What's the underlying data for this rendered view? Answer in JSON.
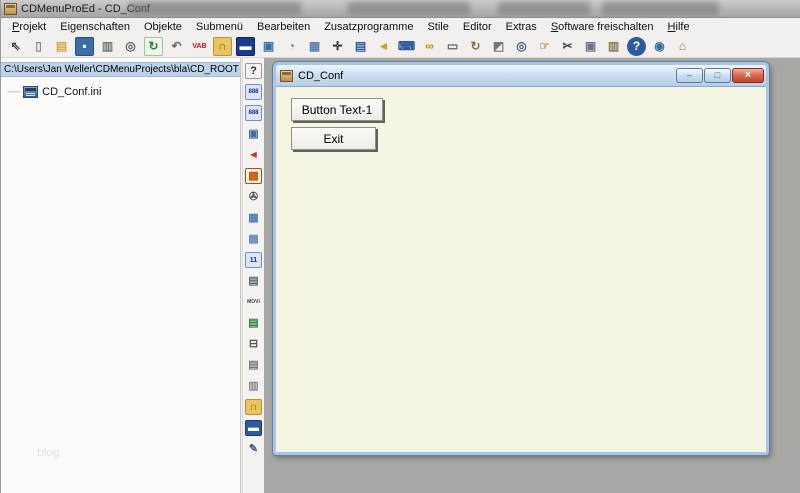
{
  "window": {
    "title": "CDMenuProEd - CD_Conf"
  },
  "menu": {
    "items": [
      {
        "name": "menu-projekt",
        "pre": "",
        "key": "P",
        "post": "rojekt"
      },
      {
        "name": "menu-eigenschaften",
        "pre": "Eigenschaften",
        "key": "",
        "post": ""
      },
      {
        "name": "menu-objekte",
        "pre": "Objekte",
        "key": "",
        "post": ""
      },
      {
        "name": "menu-submenu",
        "pre": "Submenü",
        "key": "",
        "post": ""
      },
      {
        "name": "menu-bearbeiten",
        "pre": "Bearbeiten",
        "key": "",
        "post": ""
      },
      {
        "name": "menu-zusatzprogramme",
        "pre": "Zusatzprogramme",
        "key": "",
        "post": ""
      },
      {
        "name": "menu-stile",
        "pre": "Stile",
        "key": "",
        "post": ""
      },
      {
        "name": "menu-editor",
        "pre": "Editor",
        "key": "",
        "post": ""
      },
      {
        "name": "menu-extras",
        "pre": "Extras",
        "key": "",
        "post": ""
      },
      {
        "name": "menu-software-freischalten",
        "pre": "",
        "key": "S",
        "post": "oftware freischalten"
      },
      {
        "name": "menu-hilfe",
        "pre": "",
        "key": "H",
        "post": "ilfe"
      }
    ]
  },
  "toolbar": {
    "icons": [
      {
        "name": "select-tool-icon",
        "glyph": "⇖",
        "fg": "#3a3a3a"
      },
      {
        "name": "new-file-icon",
        "glyph": "▯",
        "fg": "#8a8a8a"
      },
      {
        "name": "open-folder-icon",
        "glyph": "▤",
        "fg": "#d9a93f"
      },
      {
        "name": "save-icon",
        "glyph": "▪",
        "fg": "#ffffff",
        "bg": "#3a6ea5",
        "bd": "#28507a"
      },
      {
        "name": "print-icon",
        "glyph": "▥",
        "fg": "#6b7d6e"
      },
      {
        "name": "print-preview-icon",
        "glyph": "◎",
        "fg": "#55606e"
      },
      {
        "name": "refresh-icon",
        "glyph": "↻",
        "fg": "#2e7d32",
        "bg": "#eef6ee",
        "bd": "#9bc49d"
      },
      {
        "name": "undo-icon",
        "glyph": "↶",
        "fg": "#666666"
      },
      {
        "name": "vab-icon",
        "glyph": "VAB",
        "fg": "#cc1111",
        "fs": 7
      },
      {
        "name": "lock-icon",
        "glyph": "∩",
        "fg": "#7c5f12",
        "bg": "#eac45e",
        "bd": "#b8923a"
      },
      {
        "name": "cmd-window-icon",
        "glyph": "▬",
        "fg": "#ffffff",
        "bg": "#1b3c8c",
        "bd": "#0f2356"
      },
      {
        "name": "monitor-icon",
        "glyph": "▣",
        "fg": "#3a6ea5"
      },
      {
        "name": "screensaver-icon",
        "glyph": "◔",
        "fg": "#4a7ebb"
      },
      {
        "name": "image-icon",
        "glyph": "▦",
        "fg": "#5b7fb4"
      },
      {
        "name": "fullscreen-icon",
        "glyph": "✛",
        "fg": "#333333"
      },
      {
        "name": "window-style-icon",
        "glyph": "▤",
        "fg": "#2c5aa0"
      },
      {
        "name": "speaker-icon",
        "glyph": "◄",
        "fg": "#d4a017"
      },
      {
        "name": "keyboard-icon",
        "glyph": "⌨",
        "fg": "#2c5aa0"
      },
      {
        "name": "link-icon",
        "glyph": "∞",
        "fg": "#b8960c"
      },
      {
        "name": "selection-rect-icon",
        "glyph": "▭",
        "fg": "#666666"
      },
      {
        "name": "rotate-icon",
        "glyph": "↻",
        "fg": "#8a6b4f"
      },
      {
        "name": "resize-icon",
        "glyph": "◩",
        "fg": "#777777"
      },
      {
        "name": "find-image-icon",
        "glyph": "◎",
        "fg": "#3a5e8c"
      },
      {
        "name": "hand-icon",
        "glyph": "☞",
        "fg": "#c9a063"
      },
      {
        "name": "cut-icon",
        "glyph": "✂",
        "fg": "#444444"
      },
      {
        "name": "copy-icon",
        "glyph": "▣",
        "fg": "#6a7686"
      },
      {
        "name": "paste-icon",
        "glyph": "▥",
        "fg": "#8a7c5a"
      },
      {
        "name": "help-icon",
        "glyph": "?",
        "fg": "#ffffff",
        "bg": "#2c5aa0",
        "rd": 1
      },
      {
        "name": "web-icon",
        "glyph": "◉",
        "fg": "#3a6ea5"
      },
      {
        "name": "home-icon",
        "glyph": "⌂",
        "fg": "#a0722d"
      }
    ]
  },
  "tree_panel": {
    "path": "C:\\Users\\Jan Weller\\CDMenuProjects\\bla\\CD_ROOT",
    "items": [
      {
        "name": "tree-item-cd-conf-ini",
        "label": "CD_Conf.ini"
      }
    ],
    "watermark": "blog"
  },
  "side_toolbar": {
    "icons": [
      {
        "name": "context-help-icon",
        "glyph": "?",
        "fg": "#333333",
        "bd": "#999999"
      },
      {
        "name": "counter-display-icon",
        "glyph": "888",
        "fg": "#1a2e8c",
        "bg": "#dde6f5",
        "bd": "#7a8db8",
        "fs": 6
      },
      {
        "name": "counter-display2-icon",
        "glyph": "888",
        "fg": "#1a2e8c",
        "bg": "#dde6f5",
        "bd": "#7a8db8",
        "fs": 6
      },
      {
        "name": "windows-copy-icon",
        "glyph": "▣",
        "fg": "#3a6ea5"
      },
      {
        "name": "megaphone-icon",
        "glyph": "◄",
        "fg": "#c0392b"
      },
      {
        "name": "fire-icon",
        "glyph": "▩",
        "fg": "#d35400",
        "bd": "#b34a00"
      },
      {
        "name": "projector-icon",
        "glyph": "✇",
        "fg": "#555555"
      },
      {
        "name": "picture-icon",
        "glyph": "▦",
        "fg": "#4a7ebb"
      },
      {
        "name": "picture2-icon",
        "glyph": "▩",
        "fg": "#6c8cc0"
      },
      {
        "name": "counter11-icon",
        "glyph": "11",
        "fg": "#1a2e8c",
        "bg": "#dde6f5",
        "bd": "#7a8db8",
        "fs": 7
      },
      {
        "name": "calendar-icon",
        "glyph": "▤",
        "fg": "#556677"
      },
      {
        "name": "movie-icon",
        "glyph": "MOVI",
        "fg": "#444444",
        "fs": 5
      },
      {
        "name": "green-doc-icon",
        "glyph": "▤",
        "fg": "#2e7d32"
      },
      {
        "name": "plug-icon",
        "glyph": "⊟",
        "fg": "#555555"
      },
      {
        "name": "book-icon",
        "glyph": "▤",
        "fg": "#777777"
      },
      {
        "name": "clipboard-icon",
        "glyph": "▥",
        "fg": "#888888"
      },
      {
        "name": "lock2-icon",
        "glyph": "∩",
        "fg": "#7c5f12",
        "bg": "#eac45e",
        "bd": "#b8923a"
      },
      {
        "name": "keyboard2-icon",
        "glyph": "▬",
        "fg": "#ffffff",
        "bg": "#2c5aa0",
        "bd": "#1c3a6e"
      },
      {
        "name": "export-doc-icon",
        "glyph": "✎",
        "fg": "#3a5e8c"
      }
    ]
  },
  "document_window": {
    "title": "CD_Conf",
    "controls": [
      {
        "name": "minimize-button",
        "glyph": "–"
      },
      {
        "name": "maximize-button",
        "glyph": "□"
      },
      {
        "name": "close-button",
        "glyph": "×"
      }
    ],
    "buttons": [
      {
        "name": "button-text-1",
        "label": "Button Text-1"
      },
      {
        "name": "exit-button",
        "label": "Exit"
      }
    ]
  },
  "colors": {
    "selection_bg": "#bcd2e8",
    "doc_window_bg": "#f5f5e4",
    "workspace_bg": "#a8a8a6",
    "aero_frame": "#a9c7e4",
    "close_button_red": "#c2452e"
  }
}
